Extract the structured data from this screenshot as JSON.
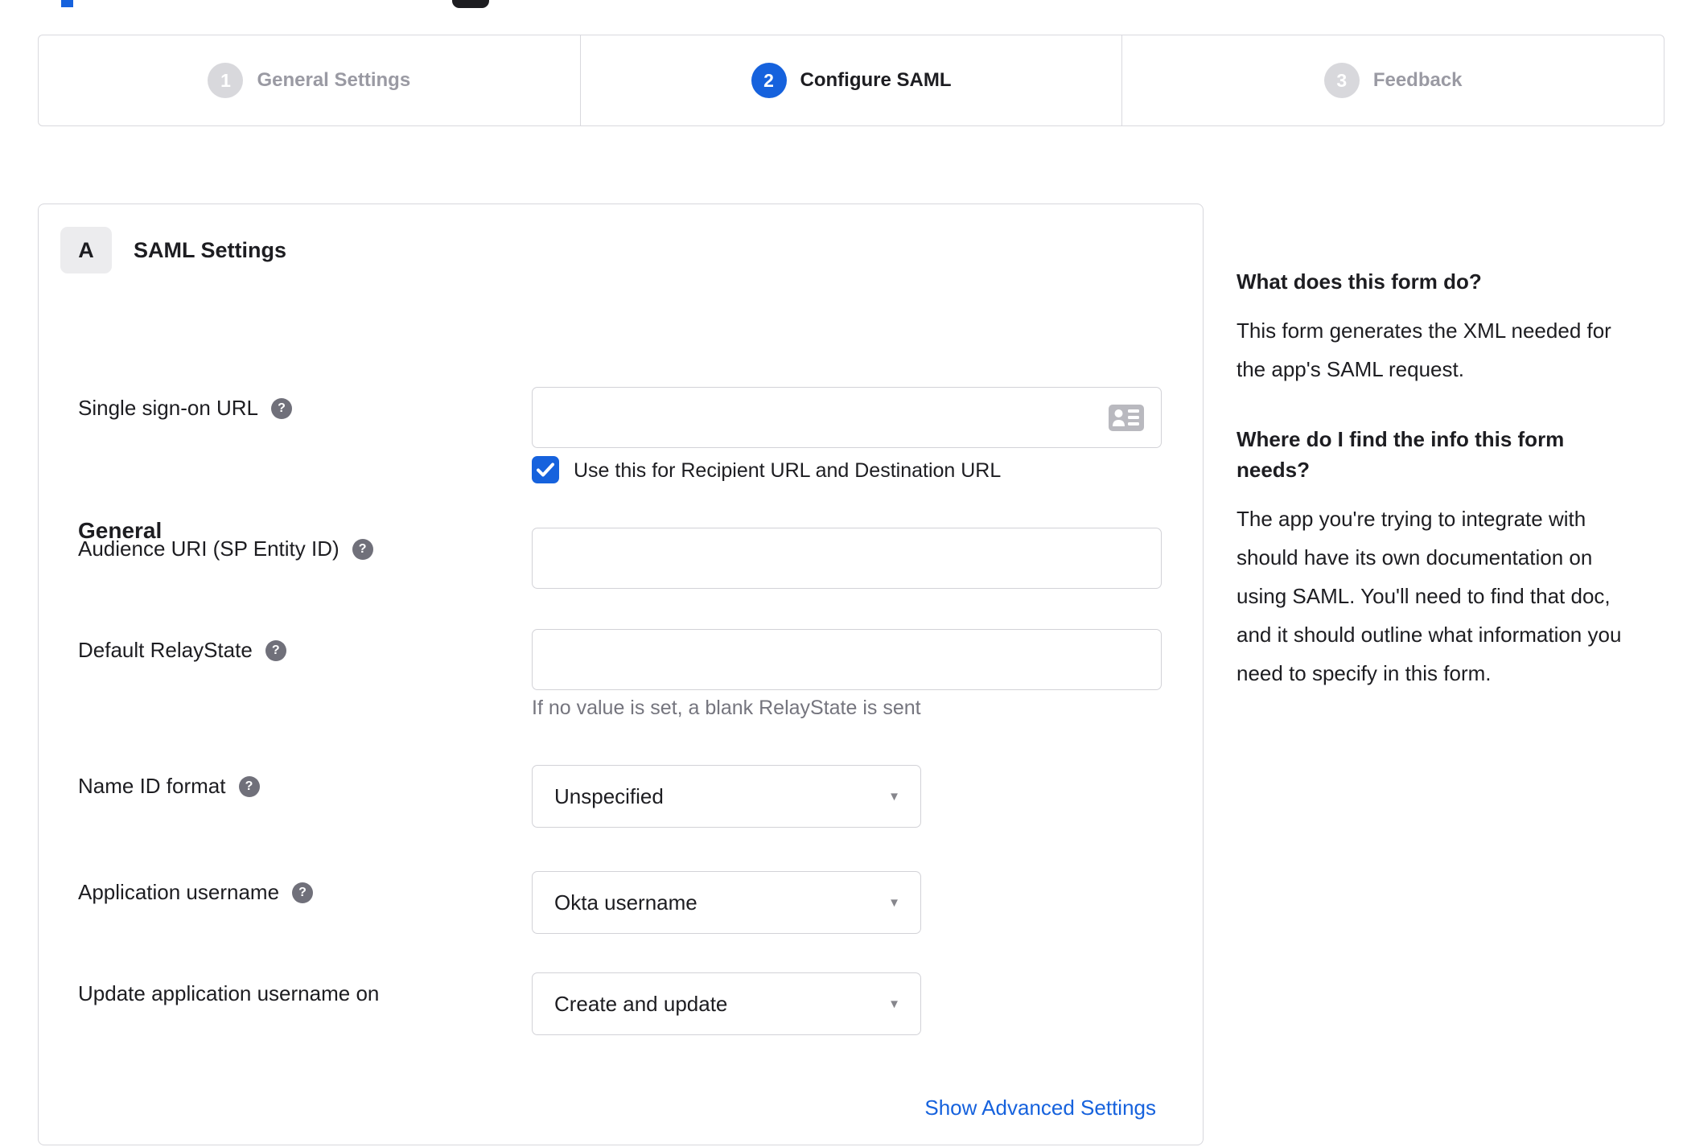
{
  "colors": {
    "accent_blue": "#1662dd",
    "text": "#1d1d21",
    "muted": "#9a9aa3",
    "border": "#d7d7dc"
  },
  "icons": {
    "help_glyph": "?",
    "caret_glyph": "▼"
  },
  "stepper": {
    "steps": [
      {
        "number": "1",
        "label": "General Settings",
        "state": "inactive"
      },
      {
        "number": "2",
        "label": "Configure SAML",
        "state": "active"
      },
      {
        "number": "3",
        "label": "Feedback",
        "state": "inactive"
      }
    ]
  },
  "panel": {
    "section_badge": "A",
    "section_title": "SAML Settings",
    "group_heading": "General",
    "fields": {
      "sso_url": {
        "label": "Single sign-on URL",
        "value": "",
        "checkbox": {
          "checked": true,
          "label": "Use this for Recipient URL and Destination URL"
        }
      },
      "audience_uri": {
        "label": "Audience URI (SP Entity ID)",
        "value": ""
      },
      "default_relay_state": {
        "label": "Default RelayState",
        "value": "",
        "helper": "If no value is set, a blank RelayState is sent"
      },
      "name_id_format": {
        "label": "Name ID format",
        "value": "Unspecified"
      },
      "app_username": {
        "label": "Application username",
        "value": "Okta username"
      },
      "update_app_username": {
        "label": "Update application username on",
        "value": "Create and update"
      }
    },
    "advanced_link": "Show Advanced Settings"
  },
  "sidebar": {
    "q1": "What does this form do?",
    "a1": "This form generates the XML needed for the app's SAML request.",
    "q2": "Where do I find the info this form needs?",
    "a2": "The app you're trying to integrate with should have its own documentation on using SAML. You'll need to find that doc, and it should outline what information you need to specify in this form."
  }
}
